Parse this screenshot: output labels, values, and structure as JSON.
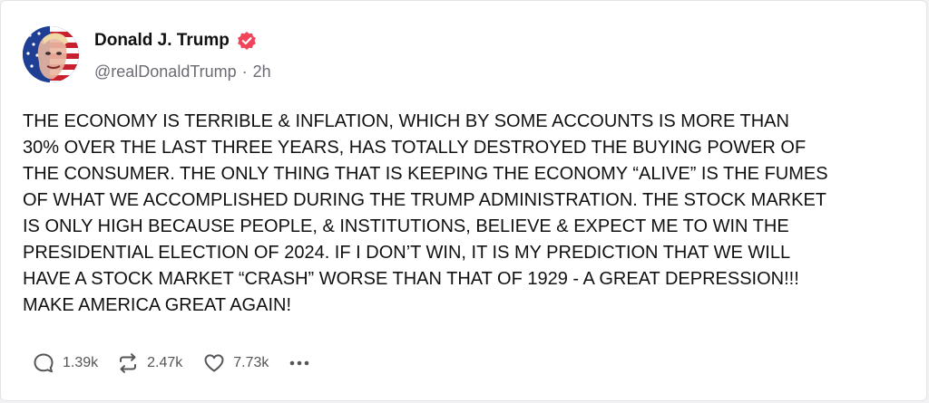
{
  "author": {
    "name": "Donald J. Trump",
    "handle": "@realDonaldTrump",
    "separator": "·",
    "time_ago": "2h",
    "verified_color": "#f0445b",
    "avatar_icon": "avatar-image"
  },
  "post": {
    "text": "THE ECONOMY IS TERRIBLE & INFLATION, WHICH BY SOME ACCOUNTS IS MORE THAN\n30% OVER THE LAST THREE YEARS, HAS TOTALLY DESTROYED THE BUYING POWER OF\nTHE CONSUMER. THE ONLY THING THAT IS KEEPING THE ECONOMY “ALIVE” IS THE FUMES\nOF WHAT WE ACCOMPLISHED DURING THE TRUMP ADMINISTRATION. THE STOCK MARKET\nIS ONLY HIGH BECAUSE PEOPLE, & INSTITUTIONS, BELIEVE & EXPECT ME TO WIN THE\nPRESIDENTIAL ELECTION OF 2024. IF I DON’T WIN, IT IS MY PREDICTION THAT WE WILL\nHAVE A STOCK MARKET “CRASH” WORSE THAN THAT OF 1929 - A GREAT DEPRESSION!!!\nMAKE AMERICA GREAT AGAIN!"
  },
  "actions": {
    "reply": {
      "icon": "reply-icon",
      "count": "1.39k"
    },
    "retruth": {
      "icon": "retruth-icon",
      "count": "2.47k"
    },
    "like": {
      "icon": "heart-icon",
      "count": "7.73k"
    },
    "more": {
      "icon": "more-icon"
    }
  }
}
